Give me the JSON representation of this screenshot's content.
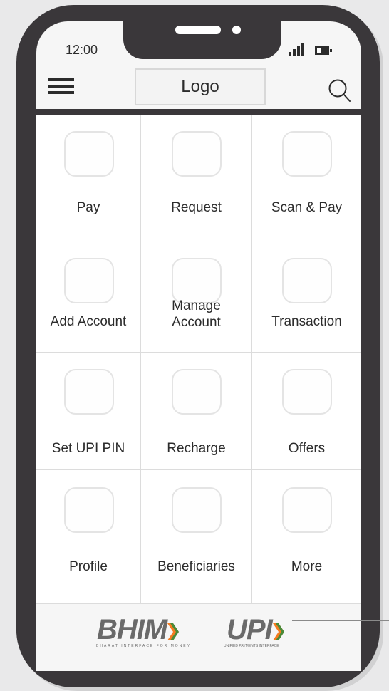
{
  "status_bar": {
    "time": "12:00",
    "signal_icon": "signal-icon",
    "battery_icon": "battery-icon",
    "battery_level": 0.4
  },
  "app_bar": {
    "menu_icon": "menu-icon",
    "logo_label": "Logo",
    "search_icon": "search-icon"
  },
  "grid": {
    "items": [
      {
        "label": "Pay"
      },
      {
        "label": "Request"
      },
      {
        "label": "Scan & Pay"
      },
      {
        "label": "Add Account"
      },
      {
        "label": "Manage\nAccount"
      },
      {
        "label": "Transaction"
      },
      {
        "label": "Set UPI PIN"
      },
      {
        "label": "Recharge"
      },
      {
        "label": "Offers"
      },
      {
        "label": "Profile"
      },
      {
        "label": "Beneficiaries"
      },
      {
        "label": "More"
      }
    ]
  },
  "footer": {
    "bhim_logo": "BHIM",
    "bhim_tagline": "BHARAT INTERFACE FOR MONEY",
    "upi_logo": "UPI",
    "upi_tagline": "UNIFIED PAYMENTS INTERFACE",
    "accent_orange": "#f47b20",
    "accent_green": "#1e8f3e"
  },
  "colors": {
    "phone_frame": "#3a373a",
    "screen_bg": "#f6f6f6",
    "grid_bg": "#ffffff",
    "text": "#2c2c2c"
  }
}
